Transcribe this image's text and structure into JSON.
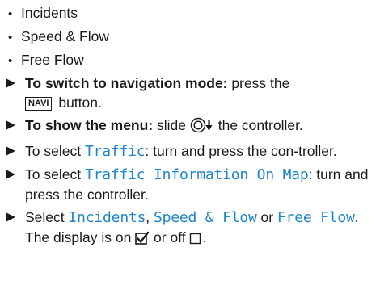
{
  "bullets": [
    "Incidents",
    "Speed & Flow",
    "Free Flow"
  ],
  "step1": {
    "bold": "To switch to navigation mode:",
    "text1": " press the",
    "key": "NAVI",
    "text2": " button."
  },
  "step2": {
    "bold": "To show the menu:",
    "text1": " slide ",
    "text2": " the controller."
  },
  "step3": {
    "text1": "To select ",
    "mono": "Traffic",
    "text2": ": turn and press the con-troller."
  },
  "step4": {
    "text1": "To select ",
    "mono": "Traffic Information On Map",
    "text2": ": turn and press the controller."
  },
  "step5": {
    "text1": "Select ",
    "mono1": "Incidents",
    "sep1": ", ",
    "mono2": "Speed & Flow",
    "sep2": " or ",
    "mono3": "Free Flow",
    "end": ".",
    "display_text1": "The display is on ",
    "display_text2": " or off ",
    "display_text3": "."
  }
}
